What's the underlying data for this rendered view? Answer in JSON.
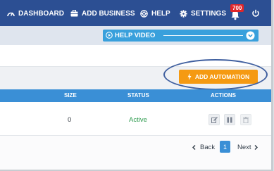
{
  "nav": {
    "dashboard": "DASHBOARD",
    "add_business": "ADD BUSINESS",
    "help": "HELP",
    "settings": "SETTINGS",
    "notification_count": "700"
  },
  "help_bar": {
    "label": "HELP VIDEO"
  },
  "toolbar": {
    "add_automation_label": "ADD AUTOMATION"
  },
  "table": {
    "columns": {
      "size": "SIZE",
      "status": "STATUS",
      "actions": "ACTIONS"
    },
    "rows": [
      {
        "size": "0",
        "status": "Active"
      }
    ]
  },
  "pagination": {
    "back": "Back",
    "page": "1",
    "next": "Next"
  },
  "colors": {
    "nav": "#2c4f93",
    "accent_blue": "#3a8fd6",
    "orange": "#f59a12",
    "status_active": "#2e9b4e",
    "badge": "#e0262a"
  }
}
